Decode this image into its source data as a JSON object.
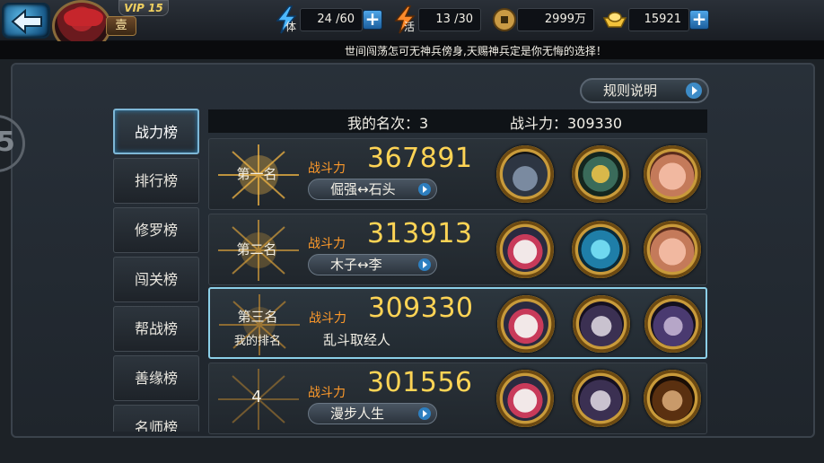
{
  "header": {
    "vip": "VIP 15",
    "level_badge": "壹",
    "stamina": {
      "tag": "体",
      "value": "24 /60"
    },
    "activity": {
      "tag": "活",
      "value": "13 /30"
    },
    "coins": {
      "value": "2999万"
    },
    "gold": {
      "value": "15921"
    }
  },
  "marquee": "世间闯荡怎可无神兵傍身,天赐神兵定是你无悔的选择！",
  "rules_button": "规则说明",
  "side_ring": "5",
  "tabs": [
    {
      "label": "战力榜"
    },
    {
      "label": "排行榜"
    },
    {
      "label": "修罗榜"
    },
    {
      "label": "闯关榜"
    },
    {
      "label": "帮战榜"
    },
    {
      "label": "善缘榜"
    },
    {
      "label": "名师榜"
    }
  ],
  "list_header": {
    "my_rank": "我的名次：3",
    "my_power": "战斗力：309330"
  },
  "rows": [
    {
      "rank": "第一名",
      "power_label": "战斗力",
      "power": "367891",
      "name": "倔强↔石头",
      "heroes": [
        "orc",
        "gold",
        "pig"
      ]
    },
    {
      "rank": "第二名",
      "power_label": "战斗力",
      "power": "313913",
      "name": "木子↔李",
      "heroes": [
        "oni",
        "beast",
        "pig"
      ]
    },
    {
      "rank": "第三名",
      "my_rank_label": "我的排名",
      "power_label": "战斗力",
      "power": "309330",
      "name": "乱斗取经人",
      "heroes": [
        "oni",
        "monk",
        "mage"
      ]
    },
    {
      "rank": "4",
      "power_label": "战斗力",
      "power": "301556",
      "name": "漫步人生",
      "heroes": [
        "oni",
        "monk",
        "warrior"
      ]
    }
  ]
}
